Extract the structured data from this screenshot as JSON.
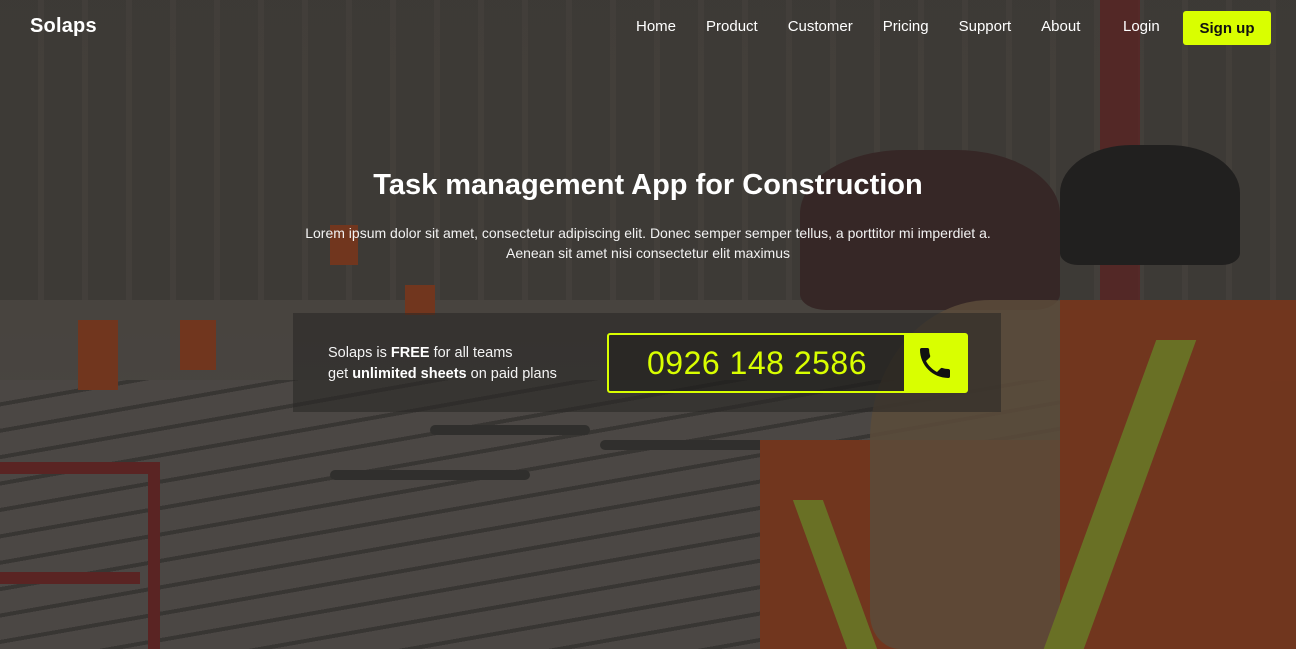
{
  "brand": "Solaps",
  "nav": {
    "items": [
      "Home",
      "Product",
      "Customer",
      "Pricing",
      "Support",
      "About"
    ],
    "login": "Login",
    "signup": "Sign up"
  },
  "hero": {
    "title": "Task management App for Construction",
    "subtitle_line1": "Lorem ipsum dolor sit amet, consectetur adipiscing elit. Donec semper semper tellus, a porttitor mi imperdiet a.",
    "subtitle_line2": "Aenean sit amet nisi consectetur elit maximus"
  },
  "offer": {
    "line1_prefix": "Solaps is ",
    "line1_bold": "FREE",
    "line1_suffix": " for all teams",
    "line2_prefix": "get ",
    "line2_bold": "unlimited sheets",
    "line2_suffix": " on paid plans"
  },
  "phone": {
    "number": "0926 148 2586",
    "icon": "phone-icon"
  },
  "colors": {
    "accent": "#d9ff00"
  }
}
